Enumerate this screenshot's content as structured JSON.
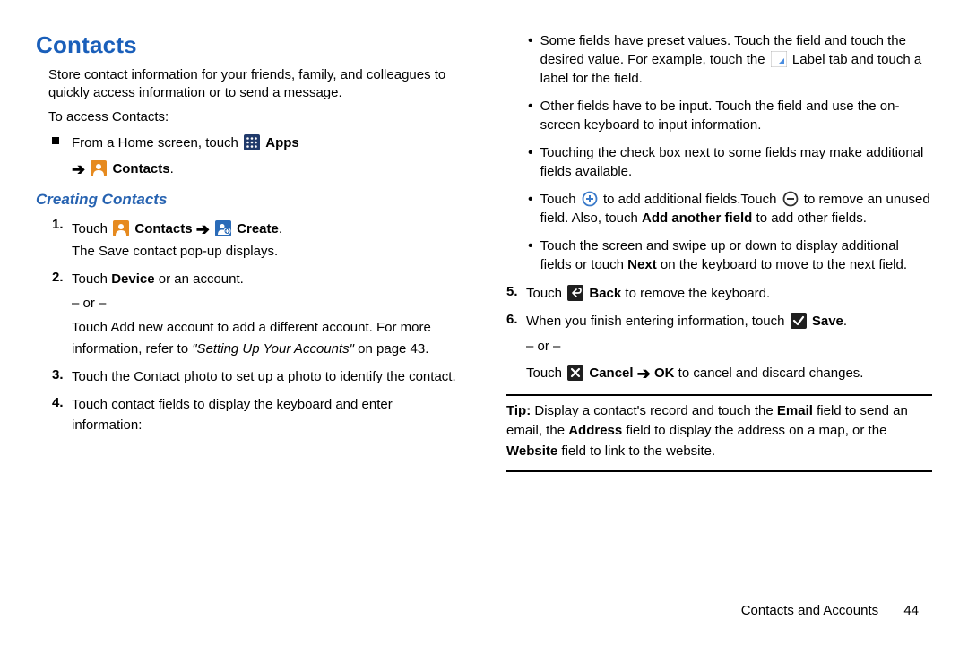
{
  "leftCol": {
    "title": "Contacts",
    "intro": "Store contact information for your friends, family, and colleagues to quickly access information or to send a message.",
    "accessHeader": "To access Contacts:",
    "accessStep_pre": "From a Home screen, touch ",
    "appsLabel": " Apps",
    "accessStep_cont": " Contacts",
    "accessStep_period": ".",
    "subTitle": "Creating Contacts",
    "step1_pre": "Touch ",
    "step1_contacts": " Contacts ",
    "step1_create": " Create",
    "step1_period": ".",
    "step1_line2": "The Save contact pop-up displays.",
    "step2_pre": "Touch ",
    "step2_device": "Device",
    "step2_post": " or an account.",
    "orText": "– or –",
    "step2_alt": "Touch Add new account to add a different account. For more information, refer to ",
    "step2_ref": "\"Setting Up Your Accounts\"",
    "step2_ref_after": " on page 43.",
    "step3": "Touch the Contact photo to set up a photo to identify the contact.",
    "step4": "Touch contact fields to display the keyboard and enter information:",
    "num1": "1.",
    "num2": "2.",
    "num3": "3.",
    "num4": "4."
  },
  "rightCol": {
    "b1_pre": "Some fields have preset values. Touch the field and touch the desired value. For example, touch the ",
    "b1_post": " Label tab and touch a label for the field.",
    "b2": "Other fields have to be input. Touch the field and use the on-screen keyboard to input information.",
    "b3": "Touching the check box next to some fields may make additional fields available.",
    "b4_pre": "Touch ",
    "b4_mid1": " to add additional fields.Touch ",
    "b4_mid2": " to remove an unused field. Also, touch ",
    "b4_bold": "Add another field",
    "b4_post": " to add other fields.",
    "b5_pre": "Touch the screen and swipe up or down to display additional fields or touch ",
    "b5_next": "Next",
    "b5_post": " on the keyboard to move to the next field.",
    "num5": "5.",
    "step5_pre": "Touch ",
    "step5_back": " Back",
    "step5_post": " to remove the keyboard.",
    "num6": "6.",
    "step6_pre": "When you finish entering information, touch ",
    "step6_save": " Save",
    "step6_period": ".",
    "orText": "– or –",
    "step6_alt_pre": "Touch ",
    "step6_cancel": " Cancel ",
    "step6_ok": " OK",
    "step6_alt_post": " to cancel and discard changes.",
    "tip_label": "Tip:",
    "tip_pre": " Display a contact's record and touch the ",
    "tip_email": "Email",
    "tip_mid1": " field to send an email, the ",
    "tip_address": "Address",
    "tip_mid2": " field to display the address on a map, or the ",
    "tip_website": "Website",
    "tip_post": " field to link to the website."
  },
  "footer": {
    "section": "Contacts and Accounts",
    "page": "44"
  }
}
